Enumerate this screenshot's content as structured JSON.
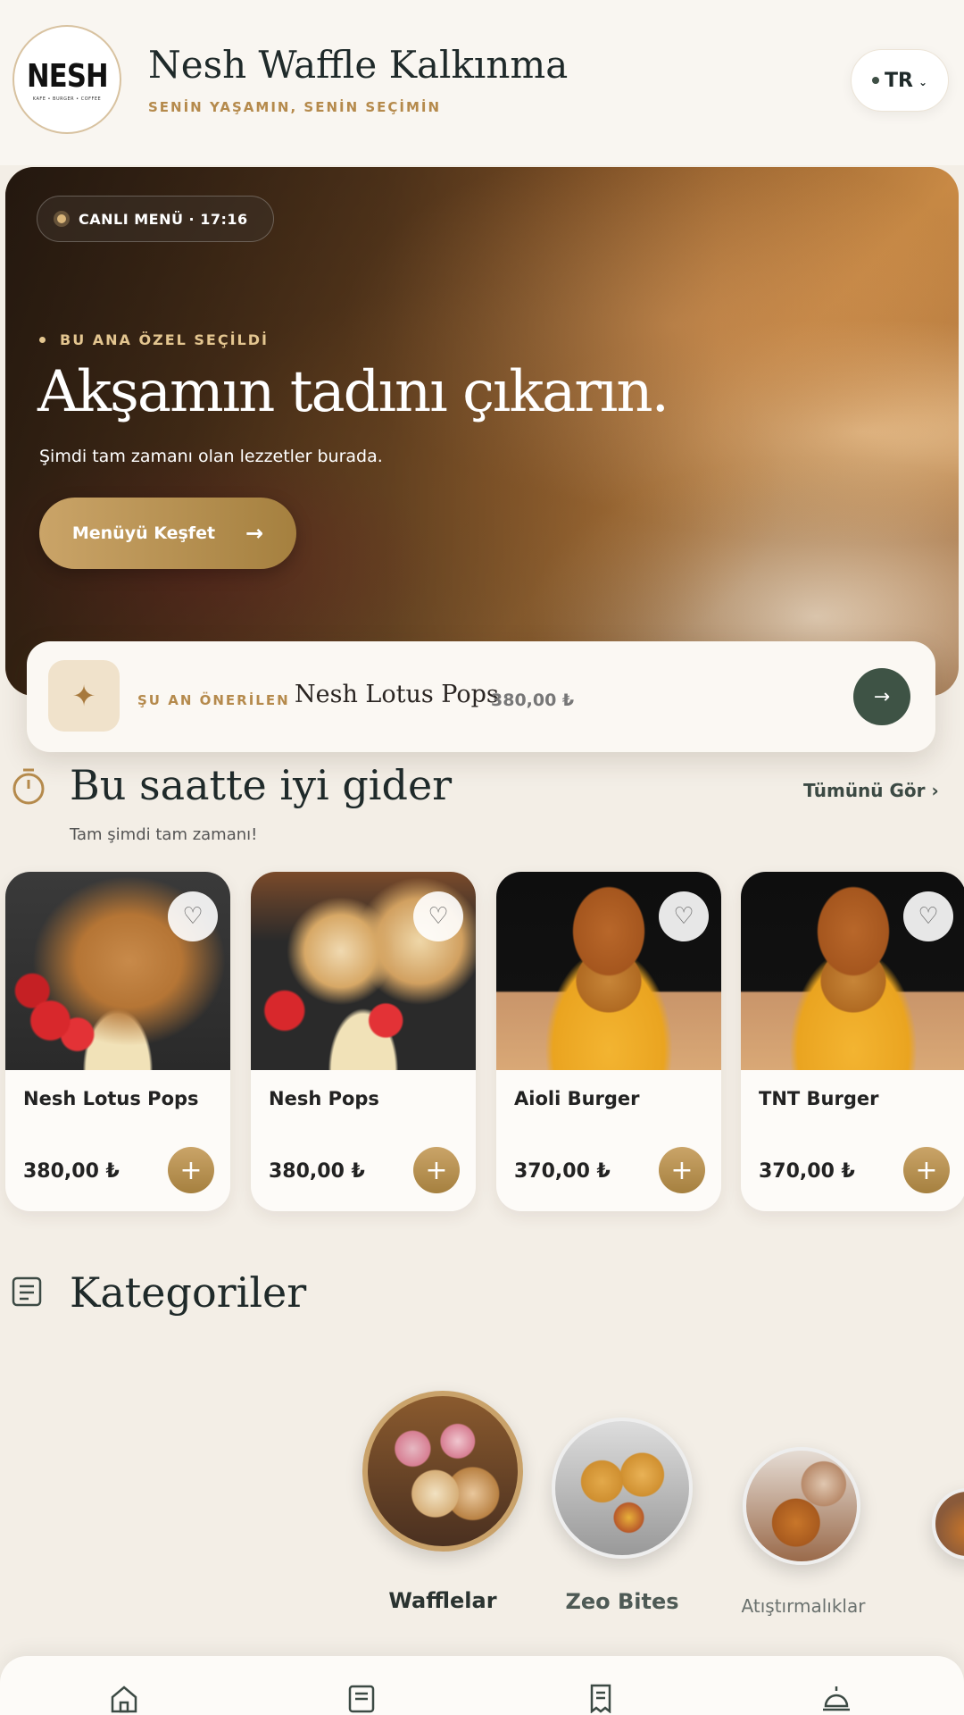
{
  "header": {
    "logo_text": "NESH",
    "logo_subtext": "KAFE • BURGER • COFFEE",
    "title": "Nesh Waffle Kalkınma",
    "subtitle": "SENİN YAŞAMIN, SENİN SEÇİMİN",
    "language": "TR"
  },
  "hero": {
    "live_label": "CANLI MENÜ · 17:16",
    "kicker": "BU ANA ÖZEL SEÇİLDİ",
    "title": "Akşamın tadını çıkarın.",
    "description": "Şimdi tam zamanı olan lezzetler burada.",
    "cta_label": "Menüyü Keşfet",
    "cta_arrow": "→"
  },
  "recommended": {
    "label": "ŞU AN ÖNERİLEN",
    "name": "Nesh Lotus Pops",
    "price": "380,00 ₺",
    "icon": "sparkle-icon",
    "arrow": "→"
  },
  "good_now": {
    "title": "Bu saatte iyi gider",
    "subtitle": "Tam şimdi tam zamanı!",
    "see_all": "Tümünü Gör ›",
    "products": [
      {
        "name": "Nesh Lotus Pops",
        "price": "380,00 ₺"
      },
      {
        "name": "Nesh Pops",
        "price": "380,00 ₺"
      },
      {
        "name": "Aioli Burger",
        "price": "370,00 ₺"
      },
      {
        "name": "TNT Burger",
        "price": "370,00 ₺"
      }
    ],
    "add_symbol": "+",
    "fav_symbol": "♡"
  },
  "categories": {
    "title": "Kategoriler",
    "items": [
      {
        "label": "Wafflelar"
      },
      {
        "label": "Zeo Bites"
      },
      {
        "label": "Atıştırmalıklar"
      },
      {
        "label": ""
      }
    ]
  },
  "colors": {
    "accent_gold": "#b58a4c",
    "dark_green": "#3e5345",
    "background": "#f3eee6"
  },
  "bottom_nav": {
    "icons": [
      "home-icon",
      "menu-book-icon",
      "order-list-icon",
      "service-bell-icon"
    ]
  }
}
